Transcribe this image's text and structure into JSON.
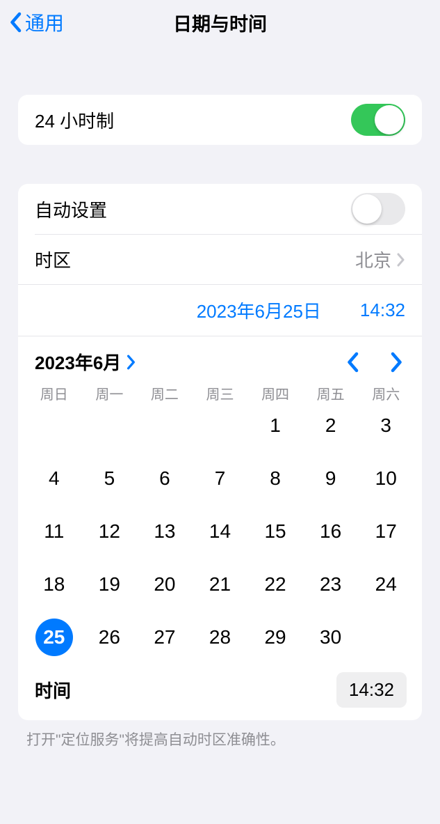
{
  "nav": {
    "back_label": "通用",
    "title": "日期与时间"
  },
  "section1": {
    "twentyfour_label": "24 小时制",
    "twentyfour_on": true
  },
  "section2": {
    "auto_label": "自动设置",
    "auto_on": false,
    "timezone_label": "时区",
    "timezone_value": "北京",
    "date_text": "2023年6月25日",
    "time_text": "14:32"
  },
  "calendar": {
    "month_label": "2023年6月",
    "weekdays": [
      "周日",
      "周一",
      "周二",
      "周三",
      "周四",
      "周五",
      "周六"
    ],
    "leading_blanks": 4,
    "days": [
      1,
      2,
      3,
      4,
      5,
      6,
      7,
      8,
      9,
      10,
      11,
      12,
      13,
      14,
      15,
      16,
      17,
      18,
      19,
      20,
      21,
      22,
      23,
      24,
      25,
      26,
      27,
      28,
      29,
      30
    ],
    "selected": 25,
    "time_label": "时间",
    "time_value": "14:32"
  },
  "footer": {
    "note": "打开\"定位服务\"将提高自动时区准确性。"
  }
}
